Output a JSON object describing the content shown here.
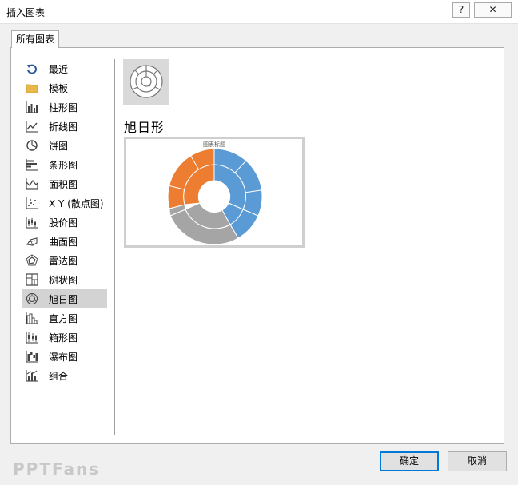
{
  "window": {
    "title": "插入图表",
    "help_label": "?",
    "close_label": "✕"
  },
  "tab": {
    "label": "所有图表"
  },
  "categories": [
    {
      "label": "最近",
      "icon": "recent-icon"
    },
    {
      "label": "模板",
      "icon": "folder-icon"
    },
    {
      "label": "柱形图",
      "icon": "column-chart-icon"
    },
    {
      "label": "折线图",
      "icon": "line-chart-icon"
    },
    {
      "label": "饼图",
      "icon": "pie-chart-icon"
    },
    {
      "label": "条形图",
      "icon": "bar-chart-icon"
    },
    {
      "label": "面积图",
      "icon": "area-chart-icon"
    },
    {
      "label": "X Y (散点图)",
      "icon": "scatter-chart-icon"
    },
    {
      "label": "股价图",
      "icon": "stock-chart-icon"
    },
    {
      "label": "曲面图",
      "icon": "surface-chart-icon"
    },
    {
      "label": "雷达图",
      "icon": "radar-chart-icon"
    },
    {
      "label": "树状图",
      "icon": "treemap-chart-icon"
    },
    {
      "label": "旭日图",
      "icon": "sunburst-chart-icon",
      "selected": true
    },
    {
      "label": "直方图",
      "icon": "histogram-chart-icon"
    },
    {
      "label": "箱形图",
      "icon": "box-chart-icon"
    },
    {
      "label": "瀑布图",
      "icon": "waterfall-chart-icon"
    },
    {
      "label": "组合",
      "icon": "combo-chart-icon"
    }
  ],
  "selected_type": {
    "title": "旭日形",
    "thumbnail_icon": "sunburst-thumbnail-icon"
  },
  "preview": {
    "chart_title": "图表标题"
  },
  "buttons": {
    "ok_label": "确定",
    "cancel_label": "取消"
  },
  "watermark": "PPTFans",
  "colors": {
    "accent_blue": "#5b9bd5",
    "accent_orange": "#ed7d31",
    "accent_gray": "#a5a5a5",
    "icon_dark": "#2b579a",
    "folder": "#e8b84c"
  }
}
